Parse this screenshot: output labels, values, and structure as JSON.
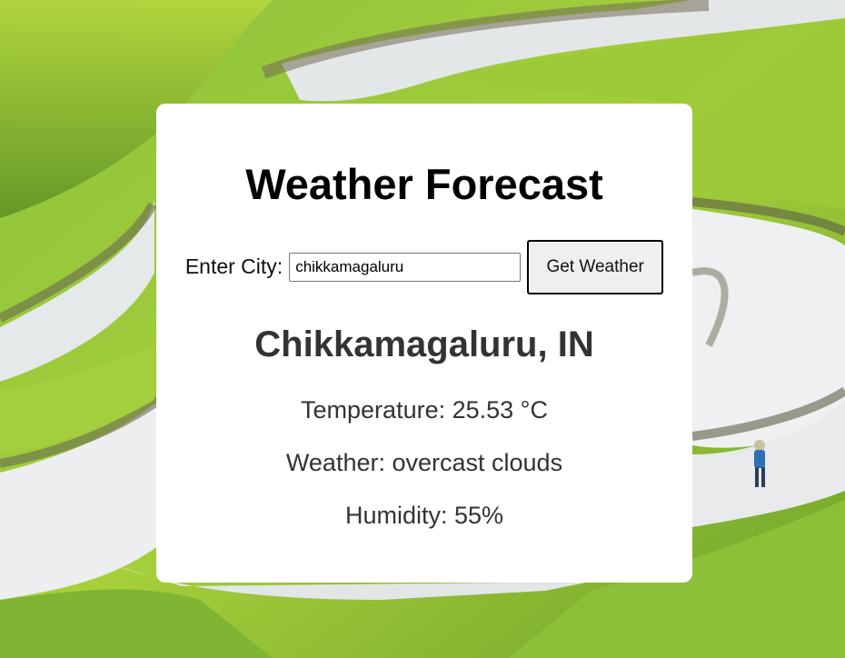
{
  "page": {
    "title": "Weather Forecast"
  },
  "form": {
    "label": "Enter City:",
    "input_value": "chikkamagaluru",
    "button_label": "Get Weather"
  },
  "result": {
    "city": "Chikkamagaluru, IN",
    "temperature": "Temperature: 25.53 °C",
    "weather": "Weather: overcast clouds",
    "humidity": "Humidity: 55%"
  },
  "colors": {
    "card_background": "#ffffff",
    "button_background": "#efefef",
    "text_dark": "#333333",
    "field_green": "#7fb236",
    "water": "#e9ebec"
  }
}
